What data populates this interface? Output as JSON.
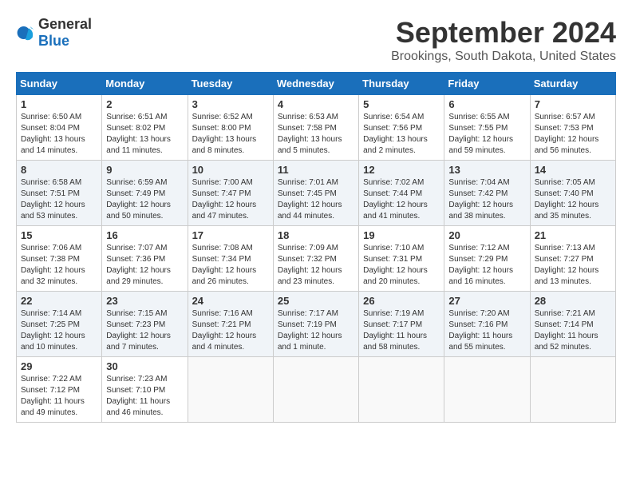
{
  "header": {
    "logo_general": "General",
    "logo_blue": "Blue",
    "month_title": "September 2024",
    "location": "Brookings, South Dakota, United States"
  },
  "weekdays": [
    "Sunday",
    "Monday",
    "Tuesday",
    "Wednesday",
    "Thursday",
    "Friday",
    "Saturday"
  ],
  "weeks": [
    [
      {
        "day": "1",
        "sunrise": "Sunrise: 6:50 AM",
        "sunset": "Sunset: 8:04 PM",
        "daylight": "Daylight: 13 hours and 14 minutes."
      },
      {
        "day": "2",
        "sunrise": "Sunrise: 6:51 AM",
        "sunset": "Sunset: 8:02 PM",
        "daylight": "Daylight: 13 hours and 11 minutes."
      },
      {
        "day": "3",
        "sunrise": "Sunrise: 6:52 AM",
        "sunset": "Sunset: 8:00 PM",
        "daylight": "Daylight: 13 hours and 8 minutes."
      },
      {
        "day": "4",
        "sunrise": "Sunrise: 6:53 AM",
        "sunset": "Sunset: 7:58 PM",
        "daylight": "Daylight: 13 hours and 5 minutes."
      },
      {
        "day": "5",
        "sunrise": "Sunrise: 6:54 AM",
        "sunset": "Sunset: 7:56 PM",
        "daylight": "Daylight: 13 hours and 2 minutes."
      },
      {
        "day": "6",
        "sunrise": "Sunrise: 6:55 AM",
        "sunset": "Sunset: 7:55 PM",
        "daylight": "Daylight: 12 hours and 59 minutes."
      },
      {
        "day": "7",
        "sunrise": "Sunrise: 6:57 AM",
        "sunset": "Sunset: 7:53 PM",
        "daylight": "Daylight: 12 hours and 56 minutes."
      }
    ],
    [
      {
        "day": "8",
        "sunrise": "Sunrise: 6:58 AM",
        "sunset": "Sunset: 7:51 PM",
        "daylight": "Daylight: 12 hours and 53 minutes."
      },
      {
        "day": "9",
        "sunrise": "Sunrise: 6:59 AM",
        "sunset": "Sunset: 7:49 PM",
        "daylight": "Daylight: 12 hours and 50 minutes."
      },
      {
        "day": "10",
        "sunrise": "Sunrise: 7:00 AM",
        "sunset": "Sunset: 7:47 PM",
        "daylight": "Daylight: 12 hours and 47 minutes."
      },
      {
        "day": "11",
        "sunrise": "Sunrise: 7:01 AM",
        "sunset": "Sunset: 7:45 PM",
        "daylight": "Daylight: 12 hours and 44 minutes."
      },
      {
        "day": "12",
        "sunrise": "Sunrise: 7:02 AM",
        "sunset": "Sunset: 7:44 PM",
        "daylight": "Daylight: 12 hours and 41 minutes."
      },
      {
        "day": "13",
        "sunrise": "Sunrise: 7:04 AM",
        "sunset": "Sunset: 7:42 PM",
        "daylight": "Daylight: 12 hours and 38 minutes."
      },
      {
        "day": "14",
        "sunrise": "Sunrise: 7:05 AM",
        "sunset": "Sunset: 7:40 PM",
        "daylight": "Daylight: 12 hours and 35 minutes."
      }
    ],
    [
      {
        "day": "15",
        "sunrise": "Sunrise: 7:06 AM",
        "sunset": "Sunset: 7:38 PM",
        "daylight": "Daylight: 12 hours and 32 minutes."
      },
      {
        "day": "16",
        "sunrise": "Sunrise: 7:07 AM",
        "sunset": "Sunset: 7:36 PM",
        "daylight": "Daylight: 12 hours and 29 minutes."
      },
      {
        "day": "17",
        "sunrise": "Sunrise: 7:08 AM",
        "sunset": "Sunset: 7:34 PM",
        "daylight": "Daylight: 12 hours and 26 minutes."
      },
      {
        "day": "18",
        "sunrise": "Sunrise: 7:09 AM",
        "sunset": "Sunset: 7:32 PM",
        "daylight": "Daylight: 12 hours and 23 minutes."
      },
      {
        "day": "19",
        "sunrise": "Sunrise: 7:10 AM",
        "sunset": "Sunset: 7:31 PM",
        "daylight": "Daylight: 12 hours and 20 minutes."
      },
      {
        "day": "20",
        "sunrise": "Sunrise: 7:12 AM",
        "sunset": "Sunset: 7:29 PM",
        "daylight": "Daylight: 12 hours and 16 minutes."
      },
      {
        "day": "21",
        "sunrise": "Sunrise: 7:13 AM",
        "sunset": "Sunset: 7:27 PM",
        "daylight": "Daylight: 12 hours and 13 minutes."
      }
    ],
    [
      {
        "day": "22",
        "sunrise": "Sunrise: 7:14 AM",
        "sunset": "Sunset: 7:25 PM",
        "daylight": "Daylight: 12 hours and 10 minutes."
      },
      {
        "day": "23",
        "sunrise": "Sunrise: 7:15 AM",
        "sunset": "Sunset: 7:23 PM",
        "daylight": "Daylight: 12 hours and 7 minutes."
      },
      {
        "day": "24",
        "sunrise": "Sunrise: 7:16 AM",
        "sunset": "Sunset: 7:21 PM",
        "daylight": "Daylight: 12 hours and 4 minutes."
      },
      {
        "day": "25",
        "sunrise": "Sunrise: 7:17 AM",
        "sunset": "Sunset: 7:19 PM",
        "daylight": "Daylight: 12 hours and 1 minute."
      },
      {
        "day": "26",
        "sunrise": "Sunrise: 7:19 AM",
        "sunset": "Sunset: 7:17 PM",
        "daylight": "Daylight: 11 hours and 58 minutes."
      },
      {
        "day": "27",
        "sunrise": "Sunrise: 7:20 AM",
        "sunset": "Sunset: 7:16 PM",
        "daylight": "Daylight: 11 hours and 55 minutes."
      },
      {
        "day": "28",
        "sunrise": "Sunrise: 7:21 AM",
        "sunset": "Sunset: 7:14 PM",
        "daylight": "Daylight: 11 hours and 52 minutes."
      }
    ],
    [
      {
        "day": "29",
        "sunrise": "Sunrise: 7:22 AM",
        "sunset": "Sunset: 7:12 PM",
        "daylight": "Daylight: 11 hours and 49 minutes."
      },
      {
        "day": "30",
        "sunrise": "Sunrise: 7:23 AM",
        "sunset": "Sunset: 7:10 PM",
        "daylight": "Daylight: 11 hours and 46 minutes."
      },
      null,
      null,
      null,
      null,
      null
    ]
  ]
}
